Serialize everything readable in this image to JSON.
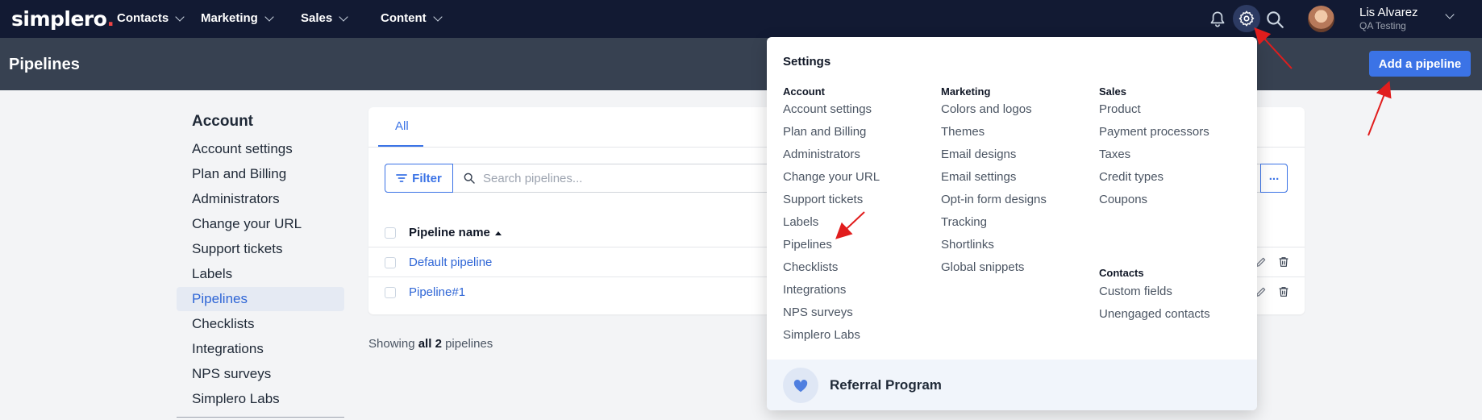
{
  "nav": {
    "logo": "simplero",
    "logo_dot": ".",
    "items": [
      "Contacts",
      "Marketing",
      "Sales",
      "Content"
    ],
    "user_name": "Lis Alvarez",
    "user_account": "QA Testing"
  },
  "header": {
    "title": "Pipelines",
    "add_button": "Add a pipeline"
  },
  "left_menu": {
    "title": "Account",
    "items": [
      "Account settings",
      "Plan and Billing",
      "Administrators",
      "Change your URL",
      "Support tickets",
      "Labels",
      "Pipelines",
      "Checklists",
      "Integrations",
      "NPS surveys",
      "Simplero Labs"
    ],
    "active": "Pipelines"
  },
  "list": {
    "tab": "All",
    "filter_label": "Filter",
    "search_placeholder": "Search pipelines...",
    "more_label": "...",
    "column_header": "Pipeline name",
    "rows": [
      "Default pipeline",
      "Pipeline#1"
    ],
    "showing_prefix": "Showing",
    "showing_count": "all 2",
    "showing_suffix": "pipelines"
  },
  "settings_menu": {
    "title": "Settings",
    "account_heading": "Account",
    "account_items": [
      "Account settings",
      "Plan and Billing",
      "Administrators",
      "Change your URL",
      "Support tickets",
      "Labels",
      "Pipelines",
      "Checklists",
      "Integrations",
      "NPS surveys",
      "Simplero Labs"
    ],
    "marketing_heading": "Marketing",
    "marketing_items": [
      "Colors and logos",
      "Themes",
      "Email designs",
      "Email settings",
      "Opt-in form designs",
      "Tracking",
      "Shortlinks",
      "Global snippets"
    ],
    "sales_heading": "Sales",
    "sales_items": [
      "Product",
      "Payment processors",
      "Taxes",
      "Credit types",
      "Coupons"
    ],
    "contacts_heading": "Contacts",
    "contacts_items": [
      "Custom fields",
      "Unengaged contacts"
    ],
    "footer_label": "Referral Program"
  },
  "colors": {
    "nav_bg": "#121a33",
    "subheader_bg": "#374151",
    "accent": "#3b73e6",
    "annotation": "#e11d1d"
  },
  "icons": [
    "bell-icon",
    "gear-icon",
    "search-icon",
    "chevron-down-icon",
    "filter-icon",
    "pencil-icon",
    "trash-icon",
    "heart-icon"
  ]
}
